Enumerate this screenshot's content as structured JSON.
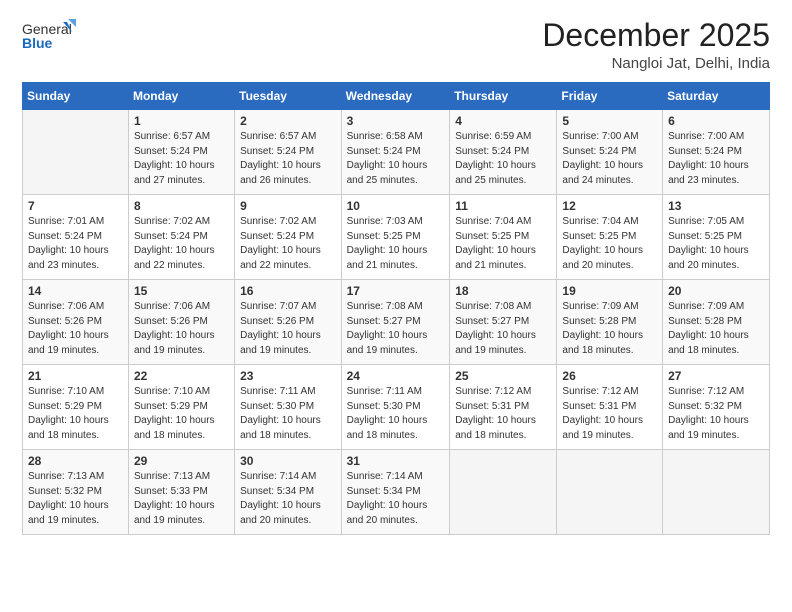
{
  "header": {
    "logo_general": "General",
    "logo_blue": "Blue",
    "title": "December 2025",
    "subtitle": "Nangloi Jat, Delhi, India"
  },
  "calendar": {
    "days_of_week": [
      "Sunday",
      "Monday",
      "Tuesday",
      "Wednesday",
      "Thursday",
      "Friday",
      "Saturday"
    ],
    "weeks": [
      [
        {
          "num": "",
          "info": ""
        },
        {
          "num": "1",
          "info": "Sunrise: 6:57 AM\nSunset: 5:24 PM\nDaylight: 10 hours\nand 27 minutes."
        },
        {
          "num": "2",
          "info": "Sunrise: 6:57 AM\nSunset: 5:24 PM\nDaylight: 10 hours\nand 26 minutes."
        },
        {
          "num": "3",
          "info": "Sunrise: 6:58 AM\nSunset: 5:24 PM\nDaylight: 10 hours\nand 25 minutes."
        },
        {
          "num": "4",
          "info": "Sunrise: 6:59 AM\nSunset: 5:24 PM\nDaylight: 10 hours\nand 25 minutes."
        },
        {
          "num": "5",
          "info": "Sunrise: 7:00 AM\nSunset: 5:24 PM\nDaylight: 10 hours\nand 24 minutes."
        },
        {
          "num": "6",
          "info": "Sunrise: 7:00 AM\nSunset: 5:24 PM\nDaylight: 10 hours\nand 23 minutes."
        }
      ],
      [
        {
          "num": "7",
          "info": "Sunrise: 7:01 AM\nSunset: 5:24 PM\nDaylight: 10 hours\nand 23 minutes."
        },
        {
          "num": "8",
          "info": "Sunrise: 7:02 AM\nSunset: 5:24 PM\nDaylight: 10 hours\nand 22 minutes."
        },
        {
          "num": "9",
          "info": "Sunrise: 7:02 AM\nSunset: 5:24 PM\nDaylight: 10 hours\nand 22 minutes."
        },
        {
          "num": "10",
          "info": "Sunrise: 7:03 AM\nSunset: 5:25 PM\nDaylight: 10 hours\nand 21 minutes."
        },
        {
          "num": "11",
          "info": "Sunrise: 7:04 AM\nSunset: 5:25 PM\nDaylight: 10 hours\nand 21 minutes."
        },
        {
          "num": "12",
          "info": "Sunrise: 7:04 AM\nSunset: 5:25 PM\nDaylight: 10 hours\nand 20 minutes."
        },
        {
          "num": "13",
          "info": "Sunrise: 7:05 AM\nSunset: 5:25 PM\nDaylight: 10 hours\nand 20 minutes."
        }
      ],
      [
        {
          "num": "14",
          "info": "Sunrise: 7:06 AM\nSunset: 5:26 PM\nDaylight: 10 hours\nand 19 minutes."
        },
        {
          "num": "15",
          "info": "Sunrise: 7:06 AM\nSunset: 5:26 PM\nDaylight: 10 hours\nand 19 minutes."
        },
        {
          "num": "16",
          "info": "Sunrise: 7:07 AM\nSunset: 5:26 PM\nDaylight: 10 hours\nand 19 minutes."
        },
        {
          "num": "17",
          "info": "Sunrise: 7:08 AM\nSunset: 5:27 PM\nDaylight: 10 hours\nand 19 minutes."
        },
        {
          "num": "18",
          "info": "Sunrise: 7:08 AM\nSunset: 5:27 PM\nDaylight: 10 hours\nand 19 minutes."
        },
        {
          "num": "19",
          "info": "Sunrise: 7:09 AM\nSunset: 5:28 PM\nDaylight: 10 hours\nand 18 minutes."
        },
        {
          "num": "20",
          "info": "Sunrise: 7:09 AM\nSunset: 5:28 PM\nDaylight: 10 hours\nand 18 minutes."
        }
      ],
      [
        {
          "num": "21",
          "info": "Sunrise: 7:10 AM\nSunset: 5:29 PM\nDaylight: 10 hours\nand 18 minutes."
        },
        {
          "num": "22",
          "info": "Sunrise: 7:10 AM\nSunset: 5:29 PM\nDaylight: 10 hours\nand 18 minutes."
        },
        {
          "num": "23",
          "info": "Sunrise: 7:11 AM\nSunset: 5:30 PM\nDaylight: 10 hours\nand 18 minutes."
        },
        {
          "num": "24",
          "info": "Sunrise: 7:11 AM\nSunset: 5:30 PM\nDaylight: 10 hours\nand 18 minutes."
        },
        {
          "num": "25",
          "info": "Sunrise: 7:12 AM\nSunset: 5:31 PM\nDaylight: 10 hours\nand 18 minutes."
        },
        {
          "num": "26",
          "info": "Sunrise: 7:12 AM\nSunset: 5:31 PM\nDaylight: 10 hours\nand 19 minutes."
        },
        {
          "num": "27",
          "info": "Sunrise: 7:12 AM\nSunset: 5:32 PM\nDaylight: 10 hours\nand 19 minutes."
        }
      ],
      [
        {
          "num": "28",
          "info": "Sunrise: 7:13 AM\nSunset: 5:32 PM\nDaylight: 10 hours\nand 19 minutes."
        },
        {
          "num": "29",
          "info": "Sunrise: 7:13 AM\nSunset: 5:33 PM\nDaylight: 10 hours\nand 19 minutes."
        },
        {
          "num": "30",
          "info": "Sunrise: 7:14 AM\nSunset: 5:34 PM\nDaylight: 10 hours\nand 20 minutes."
        },
        {
          "num": "31",
          "info": "Sunrise: 7:14 AM\nSunset: 5:34 PM\nDaylight: 10 hours\nand 20 minutes."
        },
        {
          "num": "",
          "info": ""
        },
        {
          "num": "",
          "info": ""
        },
        {
          "num": "",
          "info": ""
        }
      ]
    ]
  }
}
